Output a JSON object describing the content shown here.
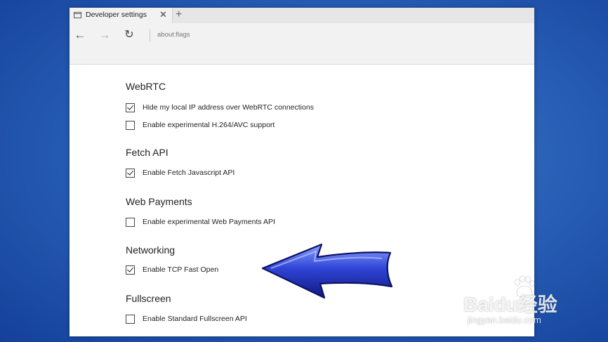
{
  "browser": {
    "tab": {
      "title": "Developer settings",
      "close": "✕"
    },
    "new_tab": "+",
    "nav": {
      "back": "←",
      "forward": "→",
      "reload": "↻"
    },
    "address": "about:flags"
  },
  "sections": [
    {
      "title": "WebRTC",
      "options": [
        {
          "label": "Hide my local IP address over WebRTC connections",
          "checked": true
        },
        {
          "label": "Enable experimental H.264/AVC support",
          "checked": false
        }
      ]
    },
    {
      "title": "Fetch API",
      "options": [
        {
          "label": "Enable Fetch Javascript API",
          "checked": true
        }
      ]
    },
    {
      "title": "Web Payments",
      "options": [
        {
          "label": "Enable experimental Web Payments API",
          "checked": false
        }
      ]
    },
    {
      "title": "Networking",
      "options": [
        {
          "label": "Enable TCP Fast Open",
          "checked": true
        }
      ]
    },
    {
      "title": "Fullscreen",
      "options": [
        {
          "label": "Enable Standard Fullscreen API",
          "checked": false
        }
      ]
    }
  ],
  "watermark": {
    "logo": "Baidu经验",
    "sub": "jingyan.baidu.com"
  },
  "colors": {
    "arrow": "#1f2fb8",
    "arrow_highlight": "#8aa0ff",
    "background": "#2a62b8"
  }
}
